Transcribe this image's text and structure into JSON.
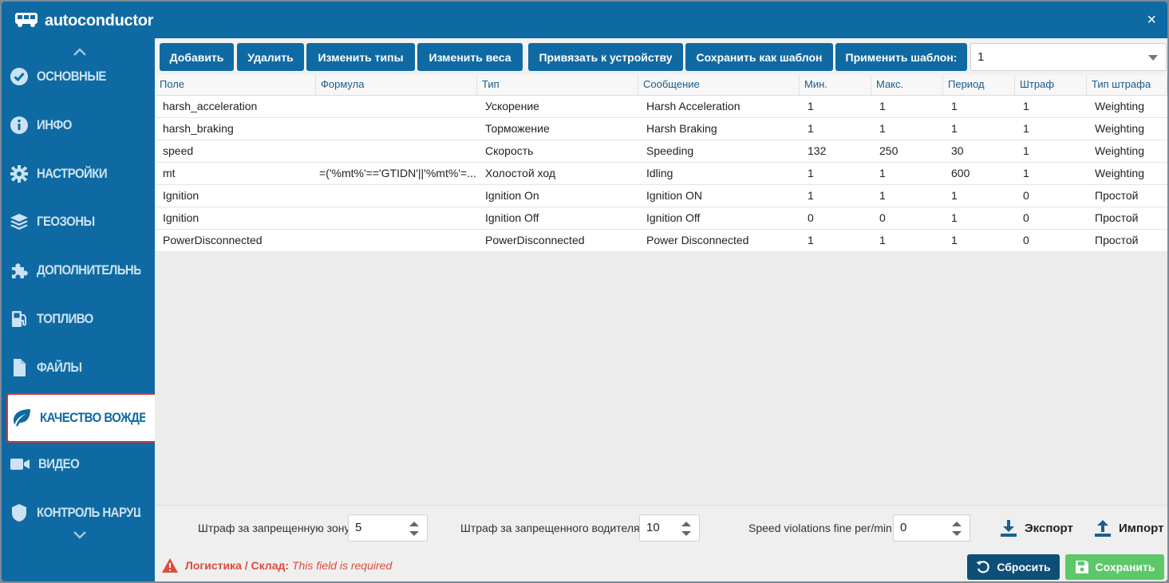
{
  "window": {
    "title": "autoconductor",
    "close_glyph": "×"
  },
  "sidebar": {
    "items": [
      {
        "label": "ОСНОВНЫЕ",
        "icon": "check-circle-icon"
      },
      {
        "label": "ИНФО",
        "icon": "info-icon"
      },
      {
        "label": "НАСТРОЙКИ",
        "icon": "gear-icon"
      },
      {
        "label": "ГЕОЗОНЫ",
        "icon": "layers-icon"
      },
      {
        "label": "ДОПОЛНИТЕЛЬНЫЕ П...",
        "icon": "puzzle-icon"
      },
      {
        "label": "ТОПЛИВО",
        "icon": "fuel-icon"
      },
      {
        "label": "ФАЙЛЫ",
        "icon": "file-icon"
      },
      {
        "label": "КАЧЕСТВО ВОЖДЕНИЯ",
        "icon": "leaf-icon",
        "active": true
      },
      {
        "label": "ВИДЕО",
        "icon": "video-icon"
      },
      {
        "label": "КОНТРОЛЬ НАРУШЕН...",
        "icon": "shield-icon"
      }
    ]
  },
  "toolbar": {
    "add": "Добавить",
    "delete": "Удалить",
    "change_types": "Изменить типы",
    "change_weights": "Изменить веса",
    "bind_device": "Привязать к устройству",
    "save_template": "Сохранить как шаблон",
    "apply_template": "Применить шаблон:",
    "template_value": "1"
  },
  "table": {
    "columns": [
      "Поле",
      "Формула",
      "Тип",
      "Сообщение",
      "Мин.",
      "Макс.",
      "Период",
      "Штраф",
      "Тип штрафа"
    ],
    "rows": [
      [
        "harsh_acceleration",
        "",
        "Ускорение",
        "Harsh Acceleration",
        "1",
        "1",
        "1",
        "1",
        "Weighting"
      ],
      [
        "harsh_braking",
        "",
        "Торможение",
        "Harsh Braking",
        "1",
        "1",
        "1",
        "1",
        "Weighting"
      ],
      [
        "speed",
        "",
        "Скорость",
        "Speeding",
        "132",
        "250",
        "30",
        "1",
        "Weighting"
      ],
      [
        "mt",
        "=('%mt%'=='GTIDN'||'%mt%'=...",
        "Холостой ход",
        "Idling",
        "1",
        "1",
        "600",
        "1",
        "Weighting"
      ],
      [
        "Ignition",
        "",
        "Ignition On",
        "Ignition ON",
        "1",
        "1",
        "1",
        "0",
        "Простой"
      ],
      [
        "Ignition",
        "",
        "Ignition Off",
        "Ignition Off",
        "0",
        "0",
        "1",
        "0",
        "Простой"
      ],
      [
        "PowerDisconnected",
        "",
        "PowerDisconnected",
        "Power Disconnected",
        "1",
        "1",
        "1",
        "0",
        "Простой"
      ]
    ]
  },
  "footer": {
    "zone_fine_label": "Штраф за запрещенную зону",
    "zone_fine_value": "5",
    "driver_fine_label": "Штраф за запрещенного водителя",
    "driver_fine_value": "10",
    "speed_fine_label": "Speed violations fine per/min",
    "speed_fine_value": "0",
    "export": "Экспорт",
    "import": "Импорт"
  },
  "status": {
    "warning_bold": "Логистика / Склад",
    "warning_sep": ":",
    "warning_text": " This field is required",
    "reset": "Сбросить",
    "save": "Сохранить"
  },
  "colors": {
    "brand": "#0f6aa3",
    "reset_button": "#0d4f78",
    "save_button": "#5cc86a",
    "warning": "#e04a3a",
    "active_border": "#e03030"
  }
}
